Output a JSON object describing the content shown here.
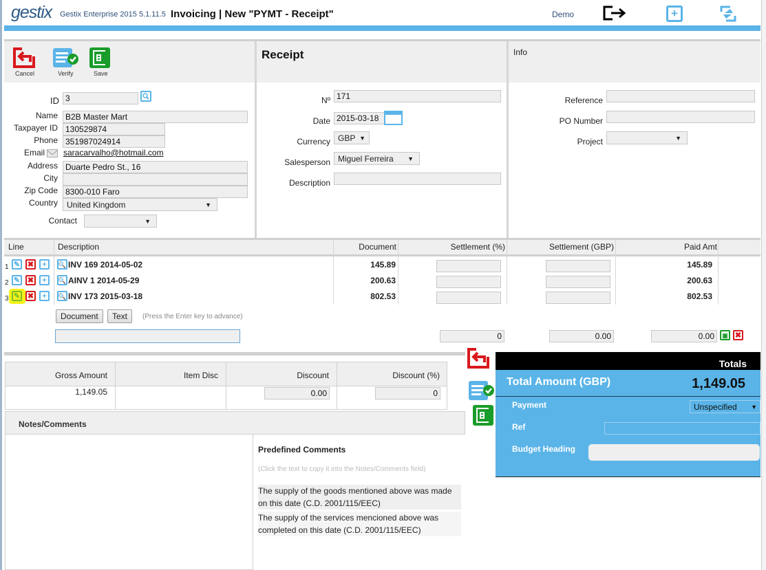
{
  "header": {
    "logo": "gestix",
    "app_name": "Gestix Enterprise 2015 5.1.11.5",
    "title": "Invoicing | New \"PYMT - Receipt\"",
    "user": "Demo"
  },
  "toolbar": {
    "cancel_label": "Cancel",
    "verify_label": "Verify",
    "save_label": "Save"
  },
  "customer": {
    "id_label": "ID",
    "id_value": "3",
    "name_label": "Name",
    "name_value": "B2B Master Mart",
    "taxpayer_label": "Taxpayer ID",
    "taxpayer_value": "130529874",
    "phone_label": "Phone",
    "phone_value": "351987024914",
    "email_label": "Email",
    "email_value": "saracarvalho@hotmail.com",
    "address_label": "Address",
    "address_value": "Duarte Pedro St., 16",
    "city_label": "City",
    "city_value": "",
    "zip_label": "Zip Code",
    "zip_value": "8300-010 Faro",
    "country_label": "Country",
    "country_value": "United Kingdom",
    "contact_label": "Contact",
    "contact_value": ""
  },
  "receipt": {
    "heading": "Receipt",
    "number_label": "Nº",
    "number_value": "171",
    "date_label": "Date",
    "date_value": "2015-03-18",
    "currency_label": "Currency",
    "currency_value": "GBP",
    "salesperson_label": "Salesperson",
    "salesperson_value": "Miguel Ferreira",
    "description_label": "Description",
    "description_value": ""
  },
  "info": {
    "heading": "Info",
    "reference_label": "Reference",
    "reference_value": "",
    "po_label": "PO Number",
    "po_value": "",
    "project_label": "Project",
    "project_value": ""
  },
  "lines": {
    "headers": [
      "Line",
      "Description",
      "Document",
      "Settlement (%)",
      "Settlement (GBP)",
      "Paid Amt"
    ],
    "rows": [
      {
        "line": "1",
        "description": "INV 169 2014-05-02",
        "document": "145.89",
        "settlement_pct": "",
        "settlement_gbp": "",
        "paid": "145.89"
      },
      {
        "line": "2",
        "description": "AINV 1 2014-05-29",
        "document": "200.63",
        "settlement_pct": "",
        "settlement_gbp": "",
        "paid": "200.63"
      },
      {
        "line": "3",
        "description": "INV 173 2015-03-18",
        "document": "802.53",
        "settlement_pct": "",
        "settlement_gbp": "",
        "paid": "802.53"
      }
    ],
    "document_button": "Document",
    "text_button": "Text",
    "hint": "(Press the Enter key to advance)",
    "new_line_value": "",
    "new_settlement_pct": "0",
    "new_settlement_gbp": "0.00",
    "new_paid": "0.00"
  },
  "summary": {
    "gross_label": "Gross Amount",
    "gross_value": "1,149.05",
    "item_disc_label": "Item Disc",
    "item_disc_value": "",
    "discount_label": "Discount",
    "discount_value": "0.00",
    "discount_pct_label": "Discount (%)",
    "discount_pct_value": "0"
  },
  "notes": {
    "heading": "Notes/Comments",
    "value": "",
    "predefined_heading": "Predefined Comments",
    "predefined_hint": "(Click the text to copy it into the Notes/Comments field)",
    "predefined": [
      "The supply of the goods mentioned above was made on this date (C.D. 2001/115/EEC)",
      "The supply of the services mencioned above was completed on this date (C.D. 2001/115/EEC)"
    ]
  },
  "totals": {
    "heading": "Totals",
    "total_label": "Total Amount (GBP)",
    "total_value": "1,149.05",
    "payment_label": "Payment",
    "payment_value": "Unspecified",
    "ref_label": "Ref",
    "ref_value": "",
    "budget_label": "Budget Heading",
    "budget_value": ""
  },
  "colors": {
    "accent_blue": "#5ab4e8",
    "cancel_red": "#d9181d",
    "save_green": "#1a9c2a",
    "highlight_yellow": "#f4f21a"
  }
}
